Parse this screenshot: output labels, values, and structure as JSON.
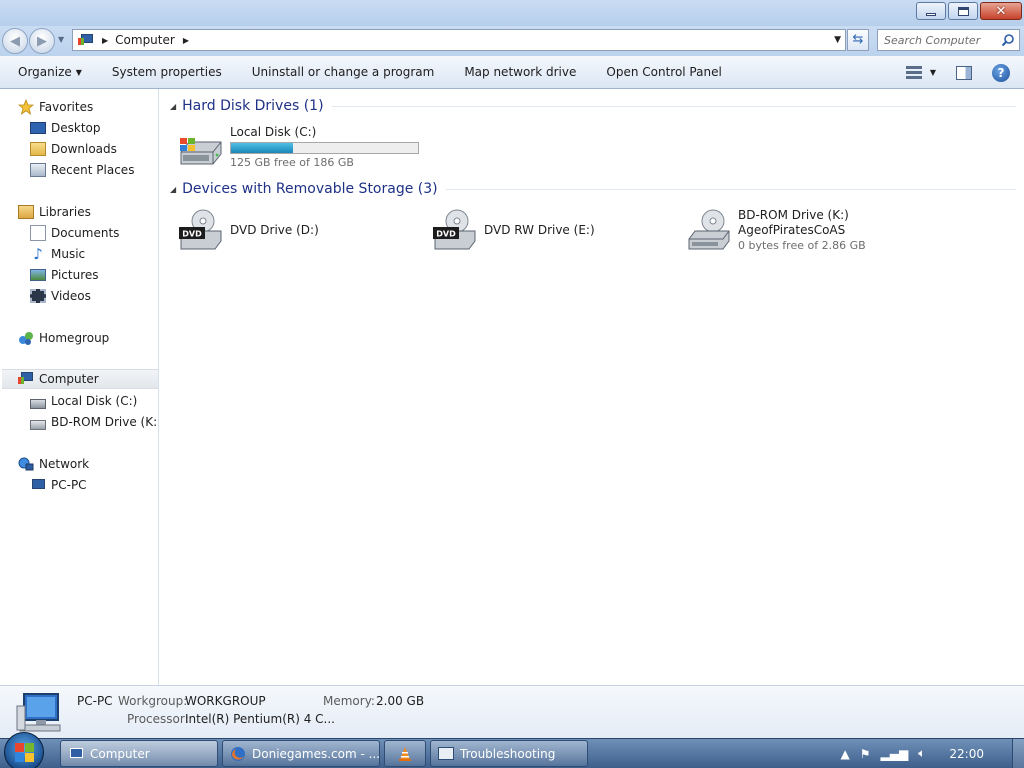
{
  "window": {
    "minimize_icon": "minimize-icon",
    "maximize_icon": "restore-icon",
    "close_icon": "close-icon"
  },
  "address": {
    "breadcrumb": [
      "Computer"
    ],
    "search_placeholder": "Search Computer"
  },
  "toolbar": {
    "organize": "Organize",
    "system_properties": "System properties",
    "uninstall": "Uninstall or change a program",
    "map_drive": "Map network drive",
    "control_panel": "Open Control Panel"
  },
  "nav": {
    "favorites": "Favorites",
    "desktop": "Desktop",
    "downloads": "Downloads",
    "recent": "Recent Places",
    "libraries": "Libraries",
    "documents": "Documents",
    "music": "Music",
    "pictures": "Pictures",
    "videos": "Videos",
    "homegroup": "Homegroup",
    "computer": "Computer",
    "local_disk": "Local Disk (C:)",
    "bd_rom": "BD-ROM Drive (K:) AgeofPiratesCoAS",
    "network": "Network",
    "pc": "PC-PC"
  },
  "groups": {
    "hdd": {
      "title": "Hard Disk Drives (1)",
      "drives": [
        {
          "name": "Local Disk (C:)",
          "free": "125 GB free of 186 GB",
          "used_fraction": 0.33
        }
      ]
    },
    "removable": {
      "title": "Devices with Removable Storage (3)",
      "drives": [
        {
          "name": "DVD Drive (D:)",
          "badge": "DVD"
        },
        {
          "name": "DVD RW Drive (E:)",
          "badge": "DVD"
        },
        {
          "name": "BD-ROM Drive (K:)",
          "label": "AgeofPiratesCoAS",
          "free": "0 bytes free of 2.86 GB"
        }
      ]
    }
  },
  "details": {
    "name": "PC-PC",
    "workgroup_label": "Workgroup:",
    "workgroup": "WORKGROUP",
    "memory_label": "Memory:",
    "memory": "2.00 GB",
    "processor_label": "Processor:",
    "processor": "Intel(R) Pentium(R) 4 C..."
  },
  "taskbar": {
    "tasks": [
      "Computer",
      "Doniegames.com - ...",
      "",
      "Troubleshooting"
    ],
    "clock": "22:00"
  }
}
